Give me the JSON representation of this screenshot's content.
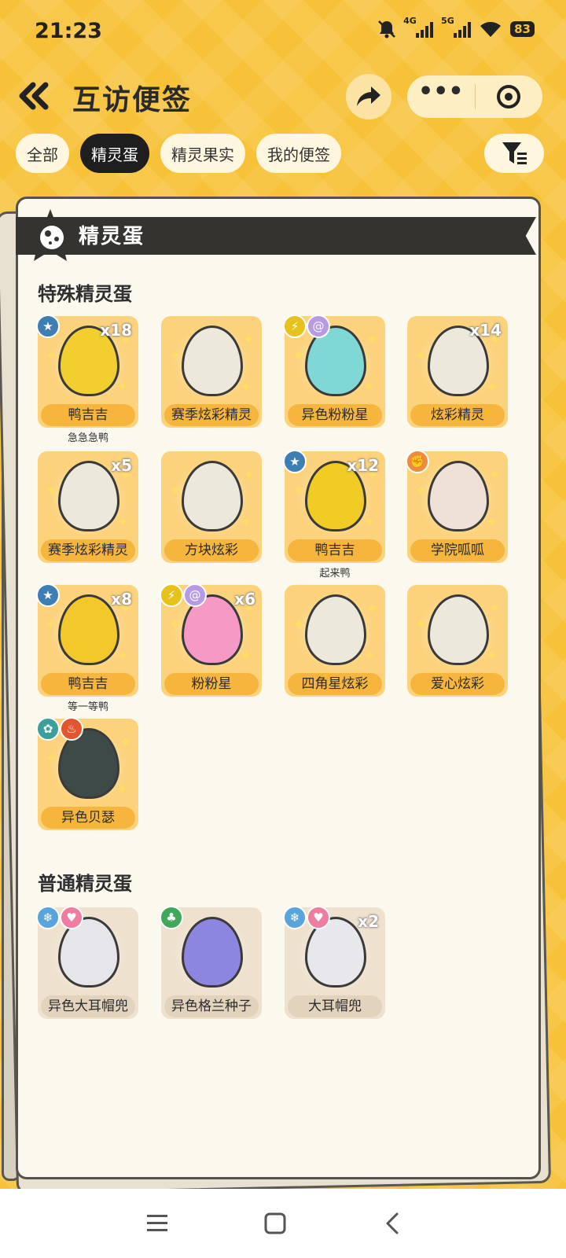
{
  "status_bar": {
    "time": "21:23",
    "net1": "4G",
    "net2": "5G",
    "battery": "83"
  },
  "header": {
    "title": "互访便签",
    "more_label": "•••"
  },
  "tabs": [
    {
      "label": "全部",
      "active": false
    },
    {
      "label": "精灵蛋",
      "active": true
    },
    {
      "label": "精灵果实",
      "active": false
    },
    {
      "label": "我的便签",
      "active": false
    }
  ],
  "banner": {
    "title": "精灵蛋"
  },
  "special_section": {
    "title": "特殊精灵蛋",
    "eggs": [
      {
        "name": "鸭吉吉",
        "count": "x18",
        "subtitle": "急急急鸭",
        "badges": [
          "star"
        ],
        "color": "#f2cf2e"
      },
      {
        "name": "赛季炫彩精灵",
        "count": "",
        "subtitle": "",
        "badges": [],
        "color": "#ece8dc"
      },
      {
        "name": "异色粉粉星",
        "count": "",
        "subtitle": "",
        "badges": [
          "electric",
          "psychic"
        ],
        "color": "#7fd8d6"
      },
      {
        "name": "炫彩精灵",
        "count": "x14",
        "subtitle": "",
        "badges": [],
        "color": "#ece8dc"
      },
      {
        "name": "赛季炫彩精灵",
        "count": "x5",
        "subtitle": "",
        "badges": [],
        "color": "#ece8dc"
      },
      {
        "name": "方块炫彩",
        "count": "",
        "subtitle": "",
        "badges": [],
        "color": "#ece8dc"
      },
      {
        "name": "鸭吉吉",
        "count": "x12",
        "subtitle": "起来鸭",
        "badges": [
          "star"
        ],
        "color": "#f0cc24"
      },
      {
        "name": "学院呱呱",
        "count": "",
        "subtitle": "",
        "badges": [
          "fighting"
        ],
        "color": "#efe0d8"
      },
      {
        "name": "鸭吉吉",
        "count": "x8",
        "subtitle": "等一等鸭",
        "badges": [
          "star"
        ],
        "color": "#f2c82a"
      },
      {
        "name": "粉粉星",
        "count": "x6",
        "subtitle": "",
        "badges": [
          "electric",
          "psychic"
        ],
        "color": "#f49ac4"
      },
      {
        "name": "四角星炫彩",
        "count": "",
        "subtitle": "",
        "badges": [],
        "color": "#ece8dc"
      },
      {
        "name": "爱心炫彩",
        "count": "",
        "subtitle": "",
        "badges": [],
        "color": "#ece8dc"
      },
      {
        "name": "异色贝瑟",
        "count": "",
        "subtitle": "",
        "badges": [
          "machine",
          "fire"
        ],
        "color": "#3e4a48"
      }
    ]
  },
  "common_section": {
    "title": "普通精灵蛋",
    "eggs": [
      {
        "name": "异色大耳帽兜",
        "count": "",
        "badges": [
          "ice",
          "fairy"
        ],
        "color": "#e6e6ea"
      },
      {
        "name": "异色格兰种子",
        "count": "",
        "badges": [
          "grass"
        ],
        "color": "#8d86e0"
      },
      {
        "name": "大耳帽兜",
        "count": "x2",
        "badges": [
          "ice",
          "fairy"
        ],
        "color": "#e8e8ec"
      }
    ]
  }
}
